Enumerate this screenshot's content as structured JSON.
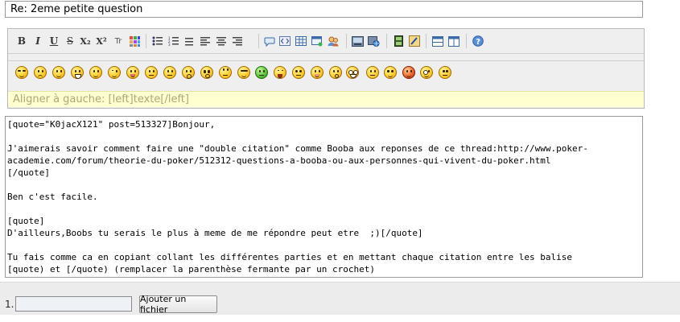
{
  "subject": {
    "value": "Re: 2eme petite question"
  },
  "toolbar": {
    "bold": "B",
    "italic": "I",
    "underline": "U",
    "strike": "S",
    "subscript": "X₂",
    "superscript": "X²",
    "teletype": "Tr"
  },
  "hint": {
    "text": "Aligner à gauche: [left]texte[/left]"
  },
  "message": {
    "text": "[quote=\"K0jacX121\" post=513327]Bonjour,\n\nJ'aimerais savoir comment faire une \"double citation\" comme Booba aux reponses de ce thread:http://www.poker-\nacademie.com/forum/theorie-du-poker/512312-questions-a-booba-ou-aux-personnes-qui-vivent-du-poker.html\n[/quote]\n\nBen c'est facile.\n\n[quote]\nD'ailleurs,Boobs tu serais le plus à meme de me répondre peut etre  ;)[/quote]\n\nTu fais comme ca en copiant collant les différentes parties et en mettant chaque citation entre les balise\n[quote) et [/quote) (remplacer la parenthèse fermante par un crochet)"
  },
  "attachments": {
    "index": "1.",
    "add_button": "Ajouter un fichier"
  }
}
